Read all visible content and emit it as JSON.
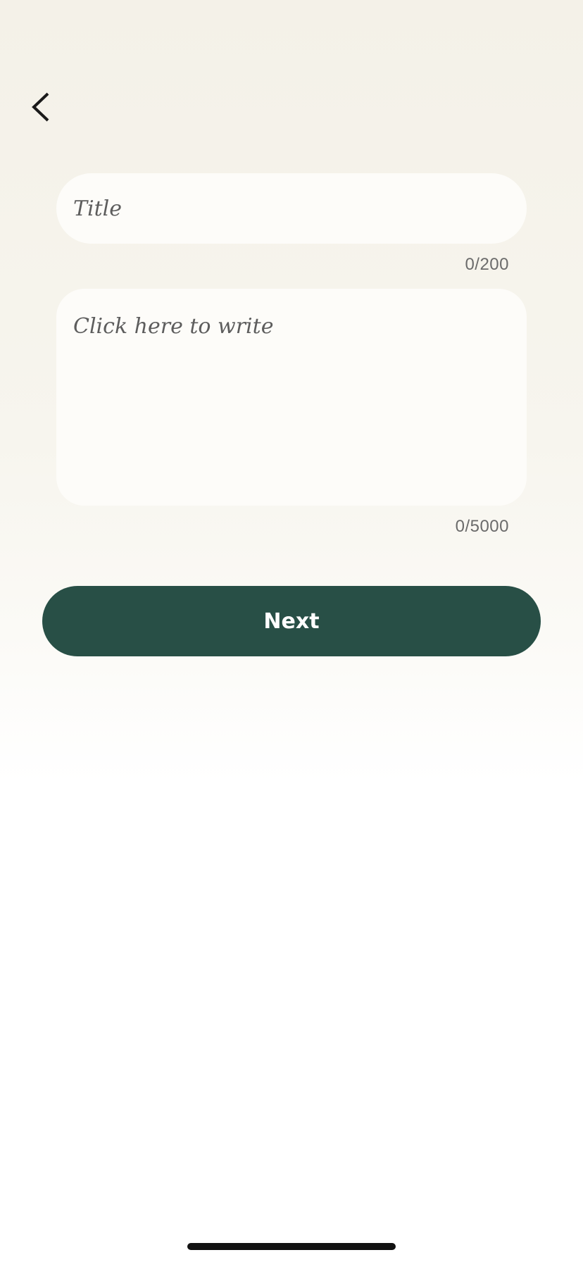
{
  "nav": {
    "back_icon": "chevron-left-icon"
  },
  "form": {
    "title_placeholder": "Title",
    "title_counter": "0/200",
    "body_placeholder": "Click here to write",
    "body_counter": "0/5000",
    "next_label": "Next"
  },
  "colors": {
    "button_bg": "#284f46",
    "button_text": "#ffffff",
    "field_bg": "#fdfcf9",
    "counter_text": "#6b6b6b"
  }
}
